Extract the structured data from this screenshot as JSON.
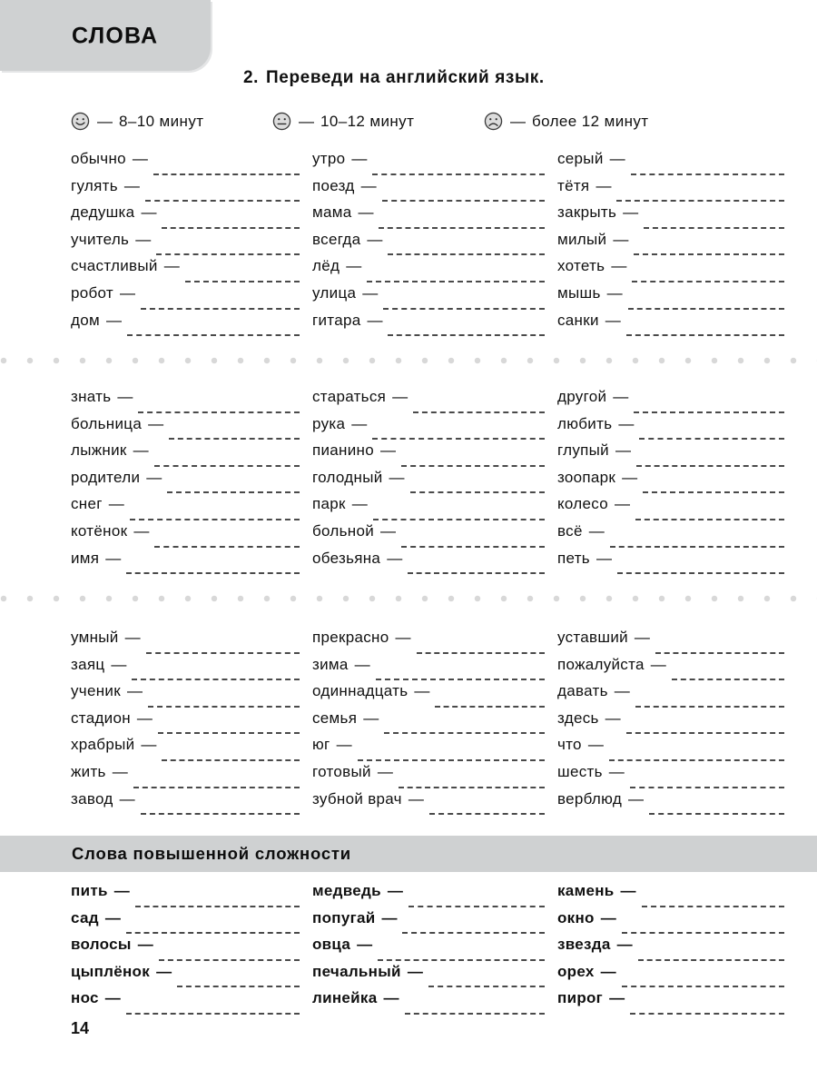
{
  "header": {
    "tab_title": "СЛОВА"
  },
  "task": {
    "number": "2.",
    "instruction": "Переведи  на  английский  язык."
  },
  "legend": {
    "dash": "—",
    "items": [
      {
        "face": "happy-face-icon",
        "label": "8–10  минут"
      },
      {
        "face": "neutral-face-icon",
        "label": "10–12  минут"
      },
      {
        "face": "sad-face-icon",
        "label": "более  12  минут"
      }
    ]
  },
  "separator_dots_color": "#d8d8d8",
  "emdash": "—",
  "blocks": [
    {
      "columns": [
        [
          "обычно",
          "гулять",
          "дедушка",
          "учитель",
          "счастливый",
          "робот",
          "дом"
        ],
        [
          "утро",
          "поезд",
          "мама",
          "всегда",
          "лёд",
          "улица",
          "гитара"
        ],
        [
          "серый",
          "тётя",
          "закрыть",
          "милый",
          "хотеть",
          "мышь",
          "санки"
        ]
      ]
    },
    {
      "columns": [
        [
          "знать",
          "больница",
          "лыжник",
          "родители",
          "снег",
          "котёнок",
          "имя"
        ],
        [
          "стараться",
          "рука",
          "пианино",
          "голодный",
          "парк",
          "больной",
          "обезьяна"
        ],
        [
          "другой",
          "любить",
          "глупый",
          "зоопарк",
          "колесо",
          "всё",
          "петь"
        ]
      ]
    },
    {
      "columns": [
        [
          "умный",
          "заяц",
          "ученик",
          "стадион",
          "храбрый",
          "жить",
          "завод"
        ],
        [
          "прекрасно",
          "зима",
          "одиннадцать",
          "семья",
          "юг",
          "готовый",
          "зубной врач"
        ],
        [
          "уставший",
          "пожалуйста",
          "давать",
          "здесь",
          "что",
          "шесть",
          "верблюд"
        ]
      ]
    }
  ],
  "advanced": {
    "title": "Слова  повышенной  сложности",
    "columns": [
      [
        "пить",
        "сад",
        "волосы",
        "цыплёнок",
        "нос"
      ],
      [
        "медведь",
        "попугай",
        "овца",
        "печальный",
        "линейка"
      ],
      [
        "камень",
        "окно",
        "звезда",
        "орех",
        "пирог"
      ]
    ]
  },
  "footer": {
    "page_number": "14"
  }
}
